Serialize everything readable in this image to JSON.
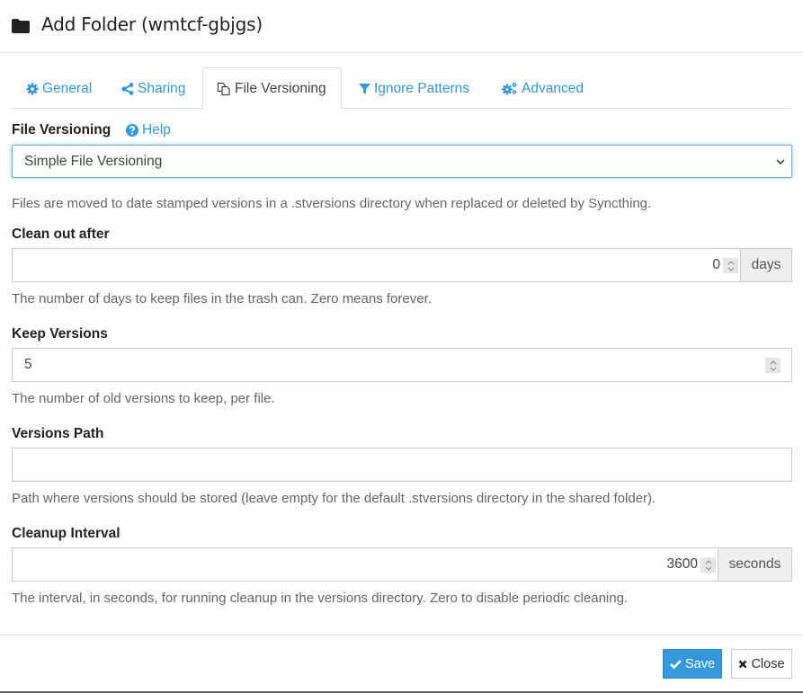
{
  "modal": {
    "title": "Add Folder (wmtcf-gbjgs)",
    "icon": "folder-icon"
  },
  "tabs": [
    {
      "label": "General",
      "icon": "gear-icon",
      "active": false
    },
    {
      "label": "Sharing",
      "icon": "share-icon",
      "active": false
    },
    {
      "label": "File Versioning",
      "icon": "copy-icon",
      "active": true
    },
    {
      "label": "Ignore Patterns",
      "icon": "filter-icon",
      "active": false
    },
    {
      "label": "Advanced",
      "icon": "gears-icon",
      "active": false
    }
  ],
  "versioning": {
    "label": "File Versioning",
    "help_label": "Help",
    "selected": "Simple File Versioning",
    "description": "Files are moved to date stamped versions in a .stversions directory when replaced or deleted by Syncthing."
  },
  "fields": {
    "clean_out": {
      "label": "Clean out after",
      "value": "0",
      "unit": "days",
      "help": "The number of days to keep files in the trash can. Zero means forever."
    },
    "keep_versions": {
      "label": "Keep Versions",
      "value": "5",
      "help": "The number of old versions to keep, per file."
    },
    "versions_path": {
      "label": "Versions Path",
      "value": "",
      "help": "Path where versions should be stored (leave empty for the default .stversions directory in the shared folder)."
    },
    "cleanup_interval": {
      "label": "Cleanup Interval",
      "value": "3600",
      "unit": "seconds",
      "help": "The interval, in seconds, for running cleanup in the versions directory. Zero to disable periodic cleaning."
    }
  },
  "footer": {
    "save_label": "Save",
    "close_label": "Close"
  },
  "colors": {
    "accent": "#3498db",
    "focus_border": "#66afe9",
    "addon_bg": "#eeeeee"
  }
}
